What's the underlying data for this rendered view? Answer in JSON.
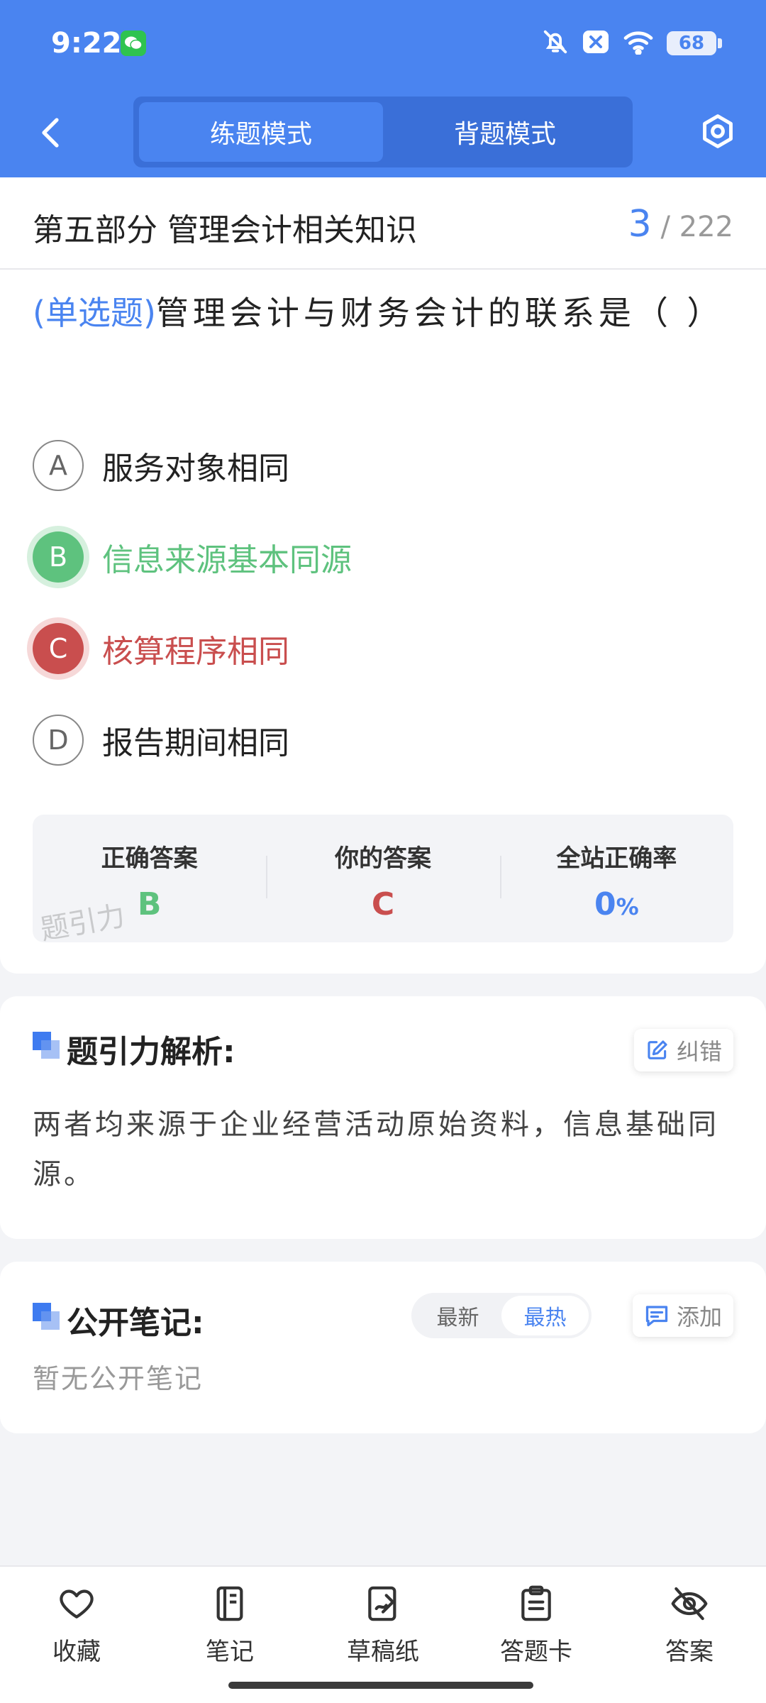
{
  "status": {
    "time": "9:22",
    "battery": "68",
    "icons": [
      "wechat-icon",
      "bell-off-icon",
      "close-badge-icon",
      "wifi-icon",
      "battery-icon"
    ]
  },
  "nav": {
    "tabs": [
      {
        "label": "练题模式",
        "active": true
      },
      {
        "label": "背题模式",
        "active": false
      }
    ]
  },
  "section": {
    "title": "第五部分 管理会计相关知识",
    "current": "3",
    "total": "/ 222"
  },
  "question": {
    "type": "(单选题)",
    "text": "管理会计与财务会计的联系是（ ）"
  },
  "options": [
    {
      "letter": "A",
      "text": "服务对象相同",
      "state": "normal"
    },
    {
      "letter": "B",
      "text": "信息来源基本同源",
      "state": "correct"
    },
    {
      "letter": "C",
      "text": "核算程序相同",
      "state": "wrong"
    },
    {
      "letter": "D",
      "text": "报告期间相同",
      "state": "normal"
    }
  ],
  "answer_summary": {
    "correct_label": "正确答案",
    "correct_value": "B",
    "yours_label": "你的答案",
    "yours_value": "C",
    "rate_label": "全站正确率",
    "rate_value": "0",
    "rate_unit": "%",
    "watermark": "题引力"
  },
  "analysis": {
    "title": "题引力解析:",
    "report_label": "纠错",
    "text": "两者均来源于企业经营活动原始资料，信息基础同源。"
  },
  "notes": {
    "title": "公开笔记:",
    "sort_options": [
      "最新",
      "最热"
    ],
    "sort_active": "最热",
    "add_label": "添加",
    "empty_text": "暂无公开笔记"
  },
  "bottom_bar": [
    {
      "label": "收藏",
      "icon": "heart-icon"
    },
    {
      "label": "笔记",
      "icon": "notebook-icon"
    },
    {
      "label": "草稿纸",
      "icon": "draft-paper-icon"
    },
    {
      "label": "答题卡",
      "icon": "answer-sheet-icon"
    },
    {
      "label": "答案",
      "icon": "eye-off-icon"
    }
  ],
  "colors": {
    "primary": "#4a84f0",
    "correct": "#5ec27e",
    "wrong": "#c94e4e"
  }
}
